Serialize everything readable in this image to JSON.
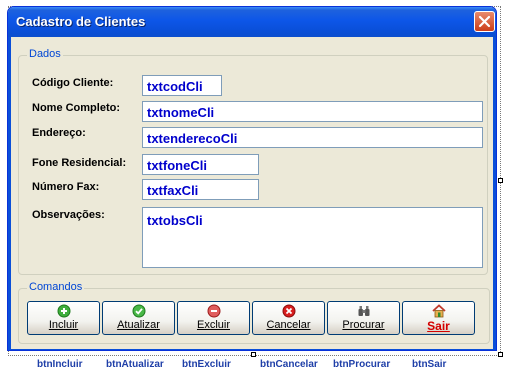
{
  "window": {
    "title": "Cadastro de Clientes"
  },
  "dados": {
    "legend": "Dados",
    "fields": [
      {
        "label": "Código Cliente:",
        "value": "txtcodCli"
      },
      {
        "label": "Nome Completo:",
        "value": "txtnomeCli"
      },
      {
        "label": "Endereço:",
        "value": "txtenderecoCli"
      },
      {
        "label": "Fone Residencial:",
        "value": "txtfoneCli"
      },
      {
        "label": "Número Fax:",
        "value": "txtfaxCli"
      },
      {
        "label": "Observações:",
        "value": "txtobsCli"
      }
    ]
  },
  "comandos": {
    "legend": "Comandos",
    "buttons": [
      {
        "label": "Incluir",
        "icon": "add-icon"
      },
      {
        "label": "Atualizar",
        "icon": "check-icon"
      },
      {
        "label": "Excluir",
        "icon": "remove-icon"
      },
      {
        "label": "Cancelar",
        "icon": "cancel-icon"
      },
      {
        "label": "Procurar",
        "icon": "binoculars-icon"
      },
      {
        "label": "Sair",
        "icon": "exit-house-icon"
      }
    ]
  },
  "tray": [
    "btnIncluir",
    "btnAtualizar",
    "btnExcluir",
    "btnCancelar",
    "btnProcurar",
    "btnSair"
  ],
  "colors": {
    "titlebar": "#0a4fd8",
    "textbox_text": "#0000cc",
    "legend": "#0046d5",
    "tray_text": "#1f3fa8"
  }
}
